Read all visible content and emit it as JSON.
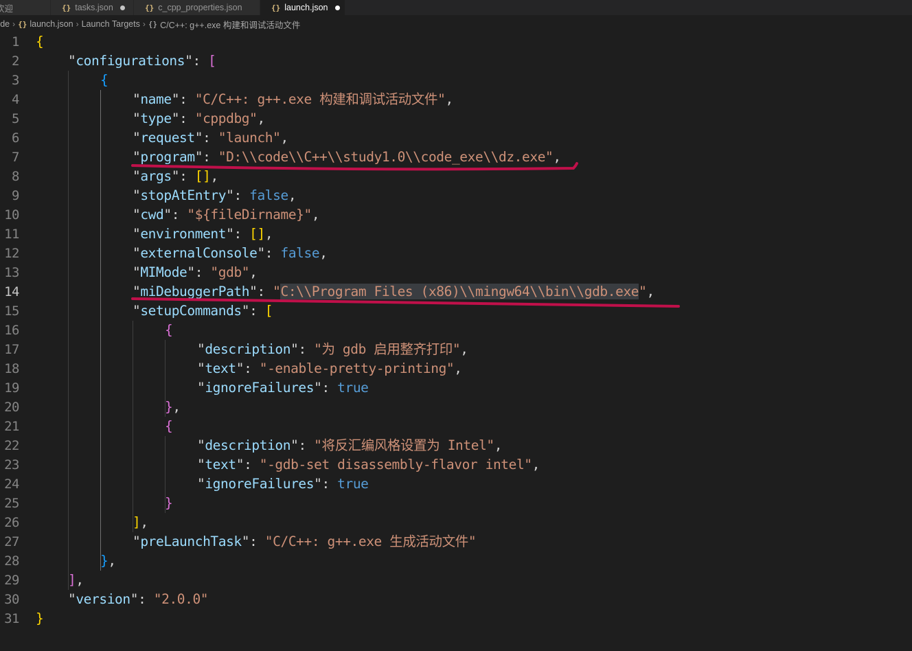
{
  "tabs": [
    {
      "label": "欢迎",
      "icon": "",
      "dirty": false,
      "active": false
    },
    {
      "label": "tasks.json",
      "icon": "{}",
      "dirty": true,
      "active": false
    },
    {
      "label": "c_cpp_properties.json",
      "icon": "{}",
      "dirty": false,
      "active": false
    },
    {
      "label": "launch.json",
      "icon": "{}",
      "dirty": true,
      "active": true
    }
  ],
  "breadcrumb": {
    "root": "code",
    "file_icon": "{}",
    "file": "launch.json",
    "section": "Launch Targets",
    "item_icon": "{}",
    "item": "C/C++: g++.exe 构建和调试活动文件"
  },
  "editor": {
    "current_line": 14,
    "lines": [
      {
        "n": "1",
        "text": "{"
      },
      {
        "n": "2",
        "text": "    \"configurations\": ["
      },
      {
        "n": "3",
        "text": "        {"
      },
      {
        "n": "4",
        "text": "            \"name\": \"C/C++: g++.exe 构建和调试活动文件\","
      },
      {
        "n": "5",
        "text": "            \"type\": \"cppdbg\","
      },
      {
        "n": "6",
        "text": "            \"request\": \"launch\","
      },
      {
        "n": "7",
        "text": "            \"program\": \"D:\\\\code\\\\C++\\\\study1.0\\\\code_exe\\\\dz.exe\","
      },
      {
        "n": "8",
        "text": "            \"args\": [],"
      },
      {
        "n": "9",
        "text": "            \"stopAtEntry\": false,"
      },
      {
        "n": "10",
        "text": "            \"cwd\": \"${fileDirname}\","
      },
      {
        "n": "11",
        "text": "            \"environment\": [],"
      },
      {
        "n": "12",
        "text": "            \"externalConsole\": false,"
      },
      {
        "n": "13",
        "text": "            \"MIMode\": \"gdb\","
      },
      {
        "n": "14",
        "text": "            \"miDebuggerPath\": \"C:\\\\Program Files (x86)\\\\mingw64\\\\bin\\\\gdb.exe\","
      },
      {
        "n": "15",
        "text": "            \"setupCommands\": ["
      },
      {
        "n": "16",
        "text": "                {"
      },
      {
        "n": "17",
        "text": "                    \"description\": \"为 gdb 启用整齐打印\","
      },
      {
        "n": "18",
        "text": "                    \"text\": \"-enable-pretty-printing\","
      },
      {
        "n": "19",
        "text": "                    \"ignoreFailures\": true"
      },
      {
        "n": "20",
        "text": "                },"
      },
      {
        "n": "21",
        "text": "                {"
      },
      {
        "n": "22",
        "text": "                    \"description\": \"将反汇编风格设置为 Intel\","
      },
      {
        "n": "23",
        "text": "                    \"text\": \"-gdb-set disassembly-flavor intel\","
      },
      {
        "n": "24",
        "text": "                    \"ignoreFailures\": true"
      },
      {
        "n": "25",
        "text": "                }"
      },
      {
        "n": "26",
        "text": "            ],"
      },
      {
        "n": "27",
        "text": "            \"preLaunchTask\": \"C/C++: g++.exe 生成活动文件\""
      },
      {
        "n": "28",
        "text": "        },"
      },
      {
        "n": "29",
        "text": "    ],"
      },
      {
        "n": "30",
        "text": "    \"version\": \"2.0.0\""
      },
      {
        "n": "31",
        "text": "}"
      }
    ]
  },
  "annotation": {
    "color": "#c0104a"
  }
}
